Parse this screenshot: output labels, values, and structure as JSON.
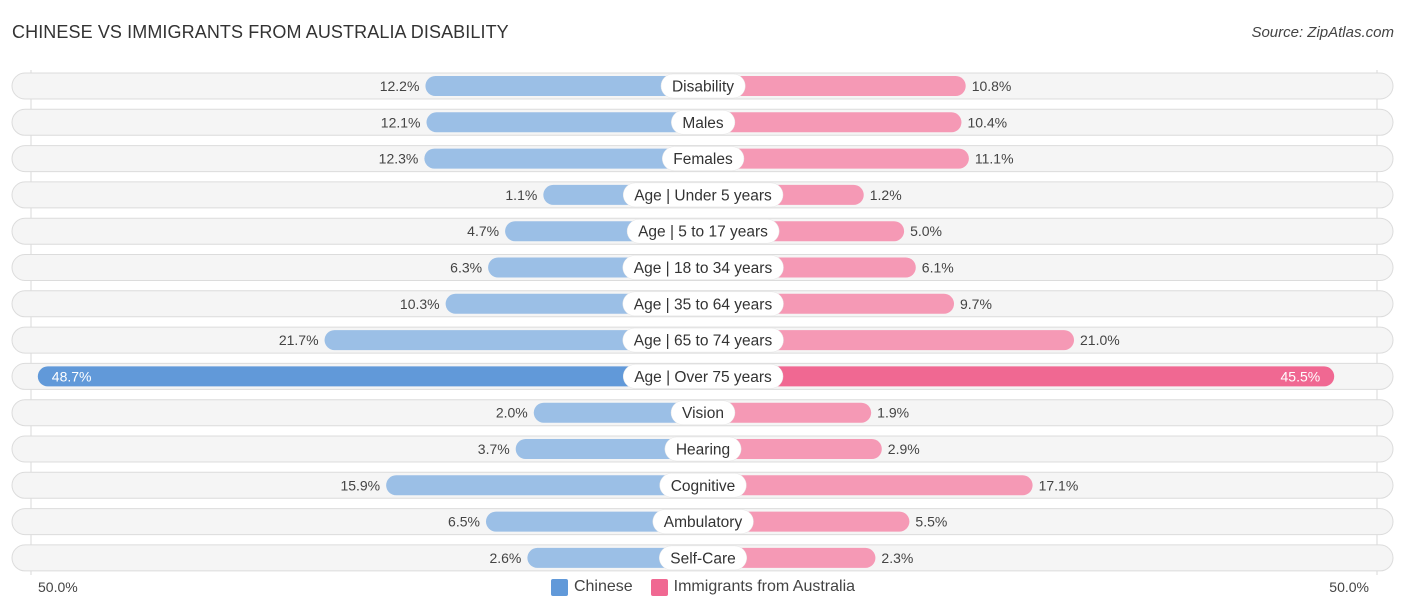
{
  "header": {
    "title": "CHINESE VS IMMIGRANTS FROM AUSTRALIA DISABILITY",
    "source": "Source: ZipAtlas.com"
  },
  "colors": {
    "chinese_light": "#9bbfe6",
    "chinese_strong": "#6199d9",
    "australia_light": "#f599b5",
    "australia_strong": "#f06892",
    "row_bg": "#f2f2f2",
    "row_border": "#dcdcdc"
  },
  "chart_data": {
    "type": "bar",
    "orientation": "horizontal-diverging",
    "title": "CHINESE VS IMMIGRANTS FROM AUSTRALIA DISABILITY",
    "categories": [
      "Disability",
      "Males",
      "Females",
      "Age | Under 5 years",
      "Age | 5 to 17 years",
      "Age | 18 to 34 years",
      "Age | 35 to 64 years",
      "Age | 65 to 74 years",
      "Age | Over 75 years",
      "Vision",
      "Hearing",
      "Cognitive",
      "Ambulatory",
      "Self-Care"
    ],
    "series": [
      {
        "name": "Chinese",
        "side": "left",
        "values": [
          12.2,
          12.1,
          12.3,
          1.1,
          4.7,
          6.3,
          10.3,
          21.7,
          48.7,
          2.0,
          3.7,
          15.9,
          6.5,
          2.6
        ]
      },
      {
        "name": "Immigrants from Australia",
        "side": "right",
        "values": [
          10.8,
          10.4,
          11.1,
          1.2,
          5.0,
          6.1,
          9.7,
          21.0,
          45.5,
          1.9,
          2.9,
          17.1,
          5.5,
          2.3
        ]
      }
    ],
    "value_labels": {
      "Chinese": [
        "12.2%",
        "12.1%",
        "12.3%",
        "1.1%",
        "4.7%",
        "6.3%",
        "10.3%",
        "21.7%",
        "48.7%",
        "2.0%",
        "3.7%",
        "15.9%",
        "6.5%",
        "2.6%"
      ],
      "Immigrants from Australia": [
        "10.8%",
        "10.4%",
        "11.1%",
        "1.2%",
        "5.0%",
        "6.1%",
        "9.7%",
        "21.0%",
        "45.5%",
        "1.9%",
        "2.9%",
        "17.1%",
        "5.5%",
        "2.3%"
      ]
    },
    "axis": {
      "left_label": "50.0%",
      "right_label": "50.0%",
      "range": [
        0,
        50
      ]
    },
    "legend": {
      "position": "bottom-center",
      "entries": [
        "Chinese",
        "Immigrants from Australia"
      ]
    }
  }
}
